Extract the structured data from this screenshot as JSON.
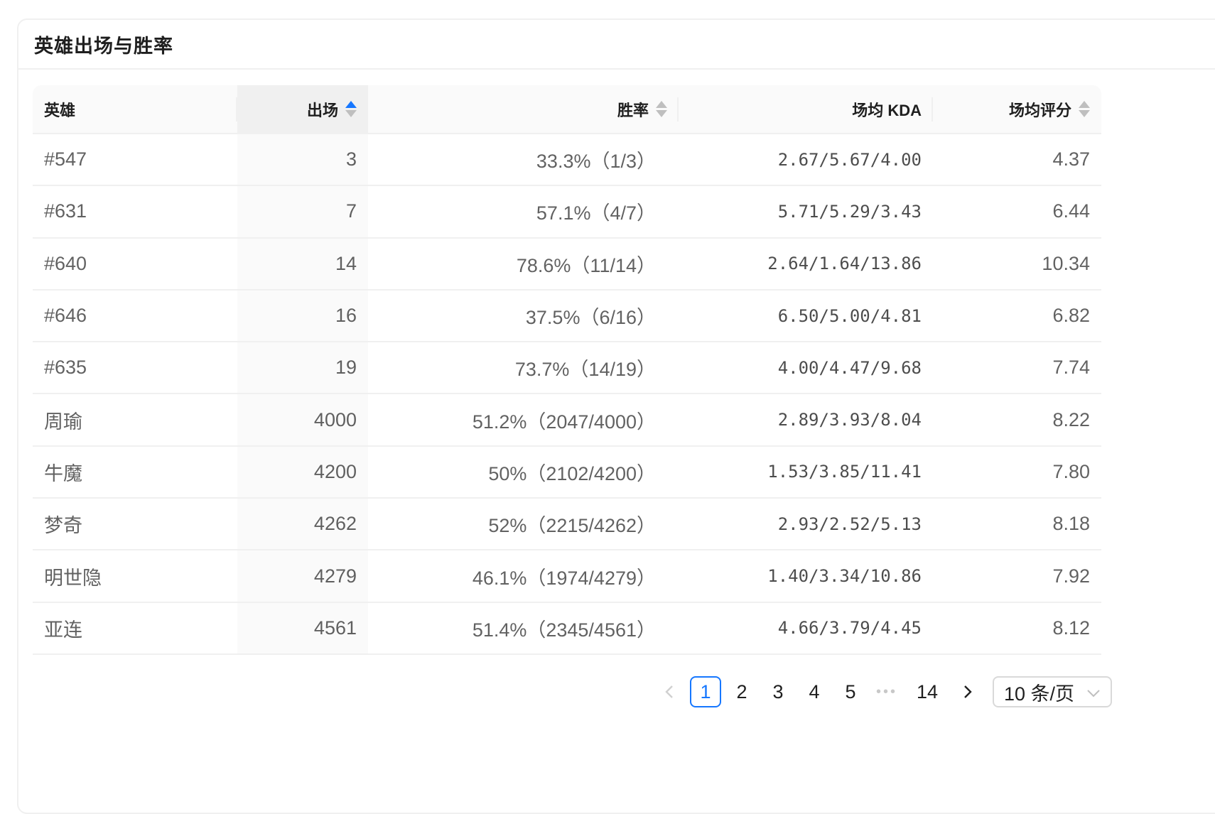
{
  "card": {
    "title": "英雄出场与胜率"
  },
  "table": {
    "columns": {
      "hero": "英雄",
      "count": "出场",
      "win_rate": "胜率",
      "kda": "场均 KDA",
      "score": "场均评分"
    },
    "sort": {
      "column": "出场",
      "order": "ascend"
    },
    "rows": [
      {
        "hero": "#547",
        "count": "3",
        "win_rate": "33.3%（1/3）",
        "kda": "2.67/5.67/4.00",
        "score": "4.37"
      },
      {
        "hero": "#631",
        "count": "7",
        "win_rate": "57.1%（4/7）",
        "kda": "5.71/5.29/3.43",
        "score": "6.44"
      },
      {
        "hero": "#640",
        "count": "14",
        "win_rate": "78.6%（11/14）",
        "kda": "2.64/1.64/13.86",
        "score": "10.34"
      },
      {
        "hero": "#646",
        "count": "16",
        "win_rate": "37.5%（6/16）",
        "kda": "6.50/5.00/4.81",
        "score": "6.82"
      },
      {
        "hero": "#635",
        "count": "19",
        "win_rate": "73.7%（14/19）",
        "kda": "4.00/4.47/9.68",
        "score": "7.74"
      },
      {
        "hero": "周瑜",
        "count": "4000",
        "win_rate": "51.2%（2047/4000）",
        "kda": "2.89/3.93/8.04",
        "score": "8.22"
      },
      {
        "hero": "牛魔",
        "count": "4200",
        "win_rate": "50%（2102/4200）",
        "kda": "1.53/3.85/11.41",
        "score": "7.80"
      },
      {
        "hero": "梦奇",
        "count": "4262",
        "win_rate": "52%（2215/4262）",
        "kda": "2.93/2.52/5.13",
        "score": "8.18"
      },
      {
        "hero": "明世隐",
        "count": "4279",
        "win_rate": "46.1%（1974/4279）",
        "kda": "1.40/3.34/10.86",
        "score": "7.92"
      },
      {
        "hero": "亚连",
        "count": "4561",
        "win_rate": "51.4%（2345/4561）",
        "kda": "4.66/3.79/4.45",
        "score": "8.12"
      }
    ]
  },
  "pagination": {
    "pages": [
      "1",
      "2",
      "3",
      "4",
      "5"
    ],
    "ellipsis": "•••",
    "last_page": "14",
    "current_page": "1",
    "page_size": "10 条/页",
    "prev_icon": "chevron-left-icon",
    "next_icon": "chevron-right-icon"
  },
  "colors": {
    "accent": "#1677ff",
    "header_bg": "#fafafa",
    "sorted_header_bg": "#f0f0f0",
    "border": "#f0f0f0"
  }
}
